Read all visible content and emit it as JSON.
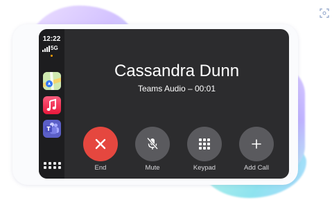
{
  "status_bar": {
    "time": "12:22",
    "network": "5G"
  },
  "call": {
    "caller_name": "Cassandra Dunn",
    "status": "Teams Audio – 00:01"
  },
  "dock": {
    "apps": [
      {
        "name": "Maps",
        "icon": "maps-icon"
      },
      {
        "name": "Music",
        "icon": "music-icon"
      },
      {
        "name": "Teams",
        "icon": "teams-icon"
      }
    ],
    "launcher_icon": "app-grid-icon"
  },
  "controls": {
    "end": {
      "label": "End",
      "icon": "close-icon",
      "color": "#e5473f"
    },
    "mute": {
      "label": "Mute",
      "icon": "microphone-slash-icon",
      "color": "#5a5a5e"
    },
    "keypad": {
      "label": "Keypad",
      "icon": "keypad-icon",
      "color": "#5a5a5e"
    },
    "add_call": {
      "label": "Add Call",
      "icon": "plus-icon",
      "color": "#5a5a5e"
    }
  },
  "colors": {
    "screen_bg": "#2c2c2e",
    "dock_bg": "#1d1d1f",
    "accent_orange": "#ff9f0a"
  }
}
